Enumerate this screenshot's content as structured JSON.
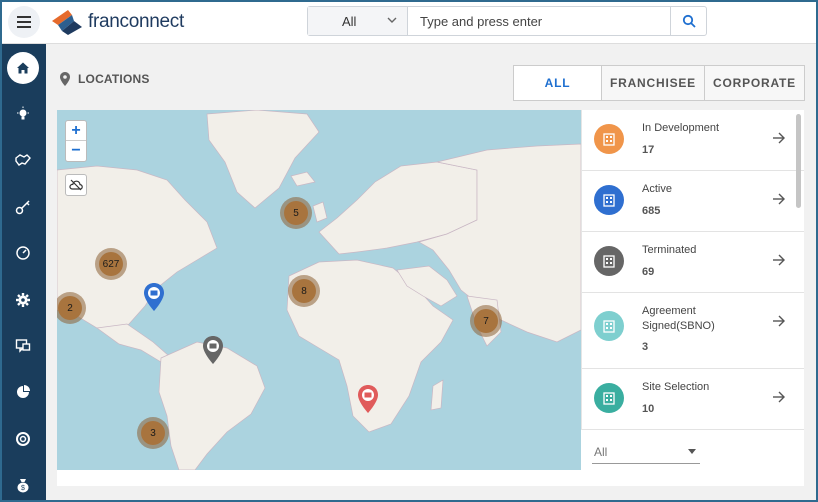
{
  "app": {
    "logo_text": "franconnect"
  },
  "search": {
    "scope": "All",
    "placeholder": "Type and press enter"
  },
  "sidebar": {
    "items": [
      {
        "icon": "home-icon",
        "active": true
      },
      {
        "icon": "lightbulb-icon",
        "active": false
      },
      {
        "icon": "handshake-icon",
        "active": false
      },
      {
        "icon": "key-icon",
        "active": false
      },
      {
        "icon": "gauge-icon",
        "active": false
      },
      {
        "icon": "gear-icon",
        "active": false
      },
      {
        "icon": "chat-icon",
        "active": false
      },
      {
        "icon": "pie-chart-icon",
        "active": false
      },
      {
        "icon": "lifebuoy-icon",
        "active": false
      },
      {
        "icon": "money-bag-icon",
        "active": false
      }
    ]
  },
  "locations": {
    "title": "LOCATIONS",
    "tabs": [
      {
        "label": "ALL",
        "active": true
      },
      {
        "label": "FRANCHISEE",
        "active": false
      },
      {
        "label": "CORPORATE",
        "active": false
      }
    ]
  },
  "map": {
    "clusters": [
      {
        "count": "5"
      },
      {
        "count": "627"
      },
      {
        "count": "8"
      },
      {
        "count": "2"
      },
      {
        "count": "7"
      },
      {
        "count": "3"
      }
    ],
    "pins": [
      {
        "status": "Active",
        "color": "#2f6fd0"
      },
      {
        "status": "Terminated",
        "color": "#666666"
      },
      {
        "status": "In Development",
        "color": "#e05b5b"
      }
    ]
  },
  "statuses": [
    {
      "label": "In Development",
      "count": "17",
      "color": "#f0954a"
    },
    {
      "label": "Active",
      "count": "685",
      "color": "#2f6fd0"
    },
    {
      "label": "Terminated",
      "count": "69",
      "color": "#666666"
    },
    {
      "label": "Agreement Signed(SBNO)",
      "count": "3",
      "color": "#7ecfcf"
    },
    {
      "label": "Site Selection",
      "count": "10",
      "color": "#3aaea0"
    }
  ],
  "filter": {
    "value": "All"
  }
}
